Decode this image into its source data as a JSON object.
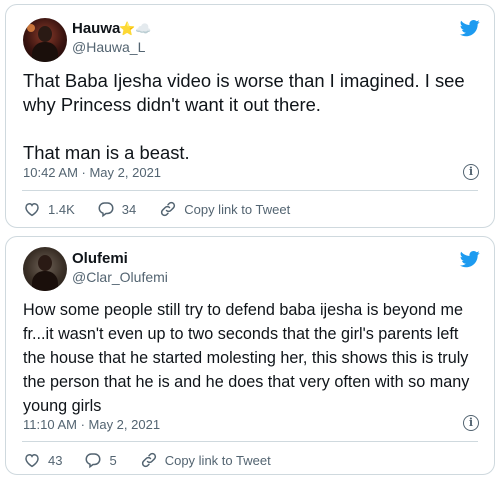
{
  "tweets": [
    {
      "name": "Hauwa",
      "badge": "⭐️☁️",
      "handle": "@Hauwa_L",
      "text": "That Baba Ijesha video is worse than I imagined. I see why Princess didn't want it out there.\n\nThat man is a beast.",
      "timestamp": "10:42 AM · May 2, 2021",
      "likes": "1.4K",
      "replies": "34",
      "copy_label": "Copy link to Tweet"
    },
    {
      "name": "Olufemi",
      "handle": "@Clar_Olufemi",
      "text": "How some people still try to defend baba ijesha is beyond me fr...it wasn't even up to two seconds that the girl's parents left the house that he started molesting her, this shows this is truly the person that he is and he does that very often with so many young girls",
      "timestamp": "11:10 AM · May 2, 2021",
      "likes": "43",
      "replies": "5",
      "copy_label": "Copy link to Tweet"
    }
  ],
  "icons": {
    "brand": "twitter-bird-icon",
    "info": "info-icon",
    "like": "heart-icon",
    "reply": "reply-bubble-icon",
    "copy": "link-icon"
  },
  "colors": {
    "twitter_blue": "#1d9bf0",
    "text": "#0f1419",
    "secondary": "#536471",
    "border": "#cfd9de"
  }
}
